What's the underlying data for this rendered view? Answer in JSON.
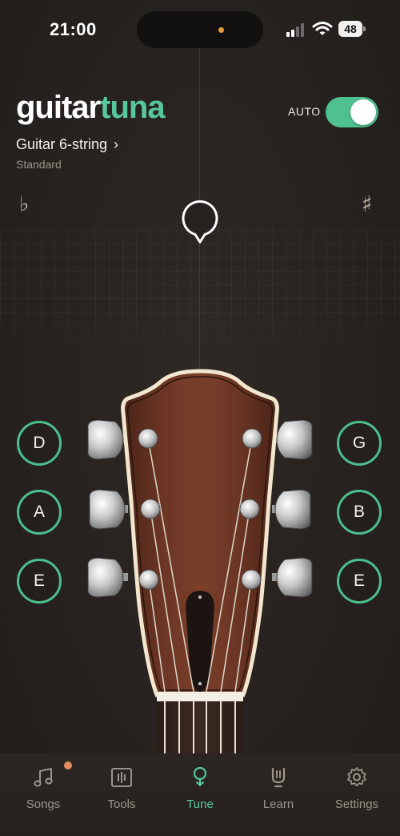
{
  "status_bar": {
    "time": "21:00",
    "battery": "48"
  },
  "header": {
    "logo_part1": "guitar",
    "logo_part2": "tuna",
    "auto_label": "AUTO",
    "auto_enabled": true,
    "instrument": "Guitar 6-string",
    "instrument_chevron": "›",
    "tuning": "Standard"
  },
  "tuner": {
    "flat_symbol": "♭",
    "sharp_symbol": "♯",
    "indicator_icon": "tuning-needle-icon"
  },
  "strings": {
    "left": [
      "D",
      "A",
      "E"
    ],
    "right": [
      "G",
      "B",
      "E"
    ]
  },
  "tab_bar": {
    "items": [
      {
        "label": "Songs",
        "icon": "music-note-icon",
        "active": false,
        "badge": true
      },
      {
        "label": "Tools",
        "icon": "tools-icon",
        "active": false,
        "badge": false
      },
      {
        "label": "Tune",
        "icon": "tuning-fork-icon",
        "active": true,
        "badge": false
      },
      {
        "label": "Learn",
        "icon": "learn-icon",
        "active": false,
        "badge": false
      },
      {
        "label": "Settings",
        "icon": "gear-icon",
        "active": false,
        "badge": false
      }
    ]
  },
  "colors": {
    "accent": "#56c89a",
    "background": "#27221f",
    "badge": "#e38a61",
    "inactive_text": "#9b948b"
  }
}
